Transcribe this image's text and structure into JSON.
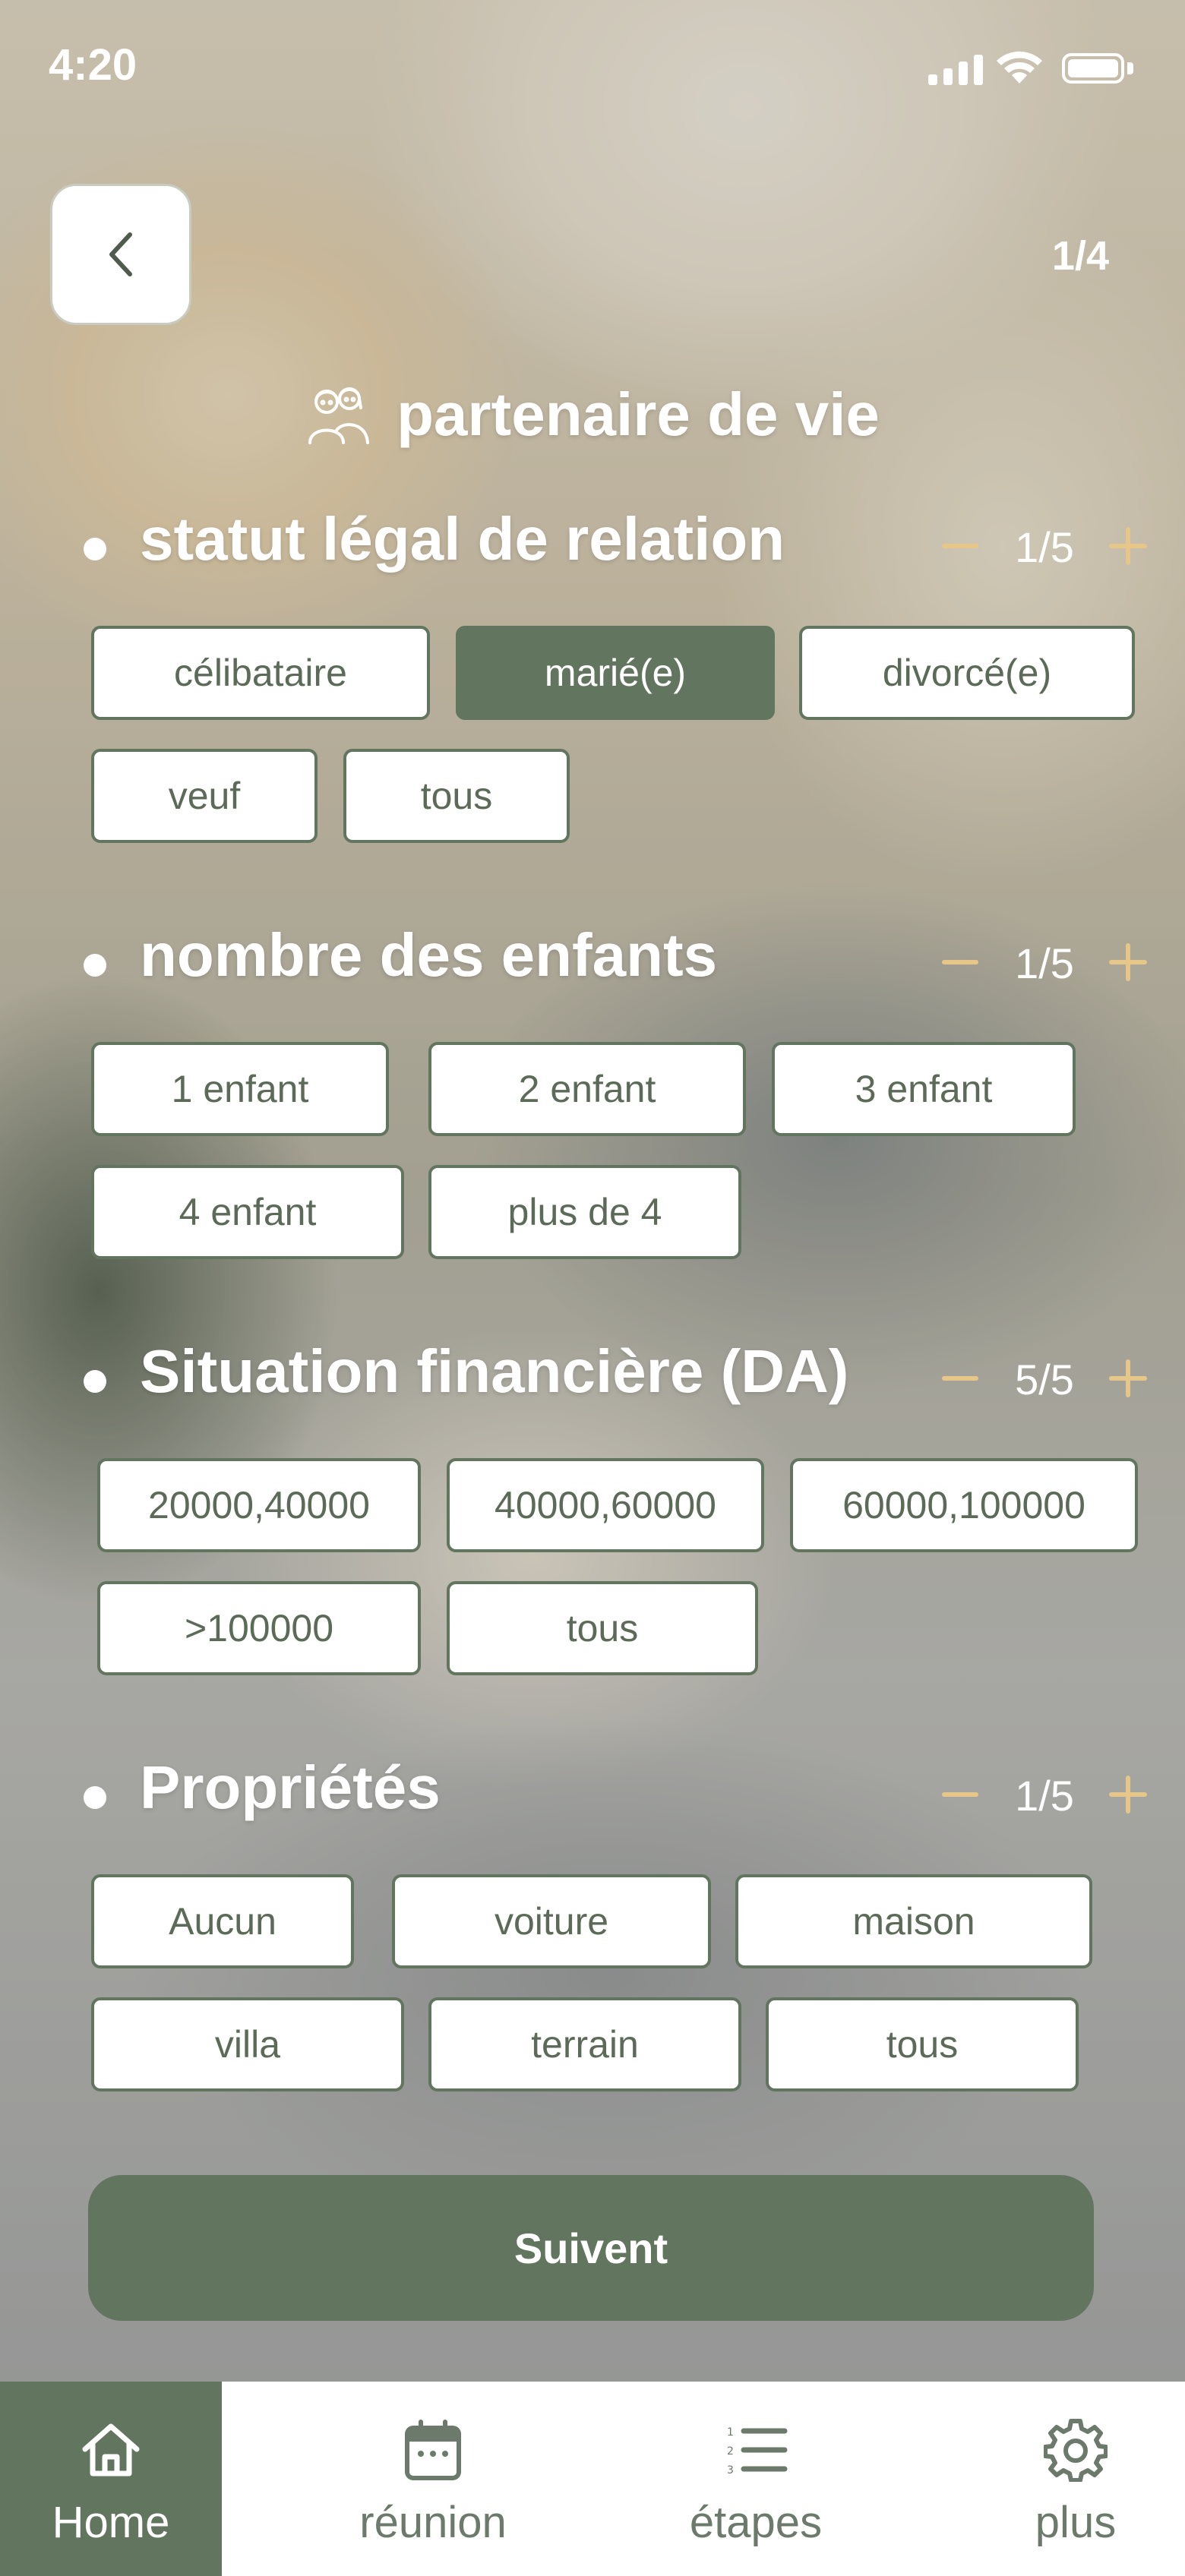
{
  "status_bar": {
    "time": "4:20"
  },
  "header": {
    "step": "1/4",
    "title": "partenaire de vie"
  },
  "sections": [
    {
      "title": "statut légal de relation",
      "count": "1/5",
      "options": [
        "célibataire",
        "marié(e)",
        "divorcé(e)",
        "veuf",
        "tous"
      ],
      "selected": "marié(e)"
    },
    {
      "title": "nombre des enfants",
      "count": "1/5",
      "options": [
        "1 enfant",
        "2 enfant",
        "3 enfant",
        "4 enfant",
        "plus de 4"
      ]
    },
    {
      "title": "Situation financière (DA)",
      "count": "5/5",
      "options": [
        "20000,40000",
        "40000,60000",
        "60000,100000",
        ">100000",
        "tous"
      ]
    },
    {
      "title": "Propriétés",
      "count": "1/5",
      "options": [
        "Aucun",
        "voiture",
        "maison",
        "villa",
        "terrain",
        "tous"
      ]
    }
  ],
  "primary_button": "Suivent",
  "tabs": [
    {
      "label": "Home",
      "icon": "home-icon",
      "active": true
    },
    {
      "label": "réunion",
      "icon": "calendar-icon"
    },
    {
      "label": "étapes",
      "icon": "numbered-list-icon"
    },
    {
      "label": "plus",
      "icon": "gear-icon"
    }
  ],
  "colors": {
    "primary_green": "#62765f",
    "accent_gold": "#e7c68a",
    "chip_text": "#5b6b58"
  }
}
